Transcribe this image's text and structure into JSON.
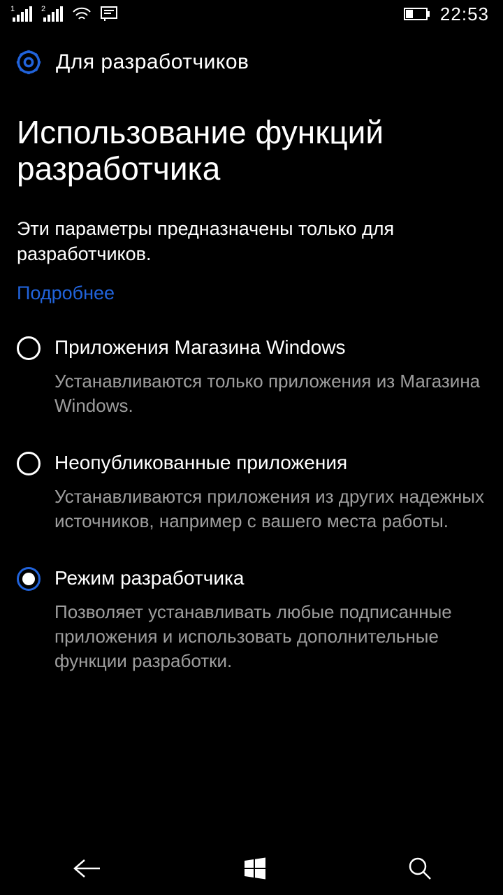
{
  "status": {
    "sim1_index": "1",
    "sim2_index": "2",
    "time": "22:53"
  },
  "header": {
    "title": "Для разработчиков"
  },
  "section": {
    "heading": "Использование функций разработчика",
    "description": "Эти параметры предназначены только для разработчиков.",
    "more_link": "Подробнее"
  },
  "options": [
    {
      "label": "Приложения Магазина Windows",
      "description": "Устанавливаются только приложения из Магазина Windows.",
      "selected": false
    },
    {
      "label": "Неопубликованные приложения",
      "description": "Устанавливаются приложения из других надежных источников, например с вашего места работы.",
      "selected": false
    },
    {
      "label": "Режим разработчика",
      "description": "Позволяет устанавливать любые подписанные приложения и использовать дополнительные функции разработки.",
      "selected": true
    }
  ]
}
